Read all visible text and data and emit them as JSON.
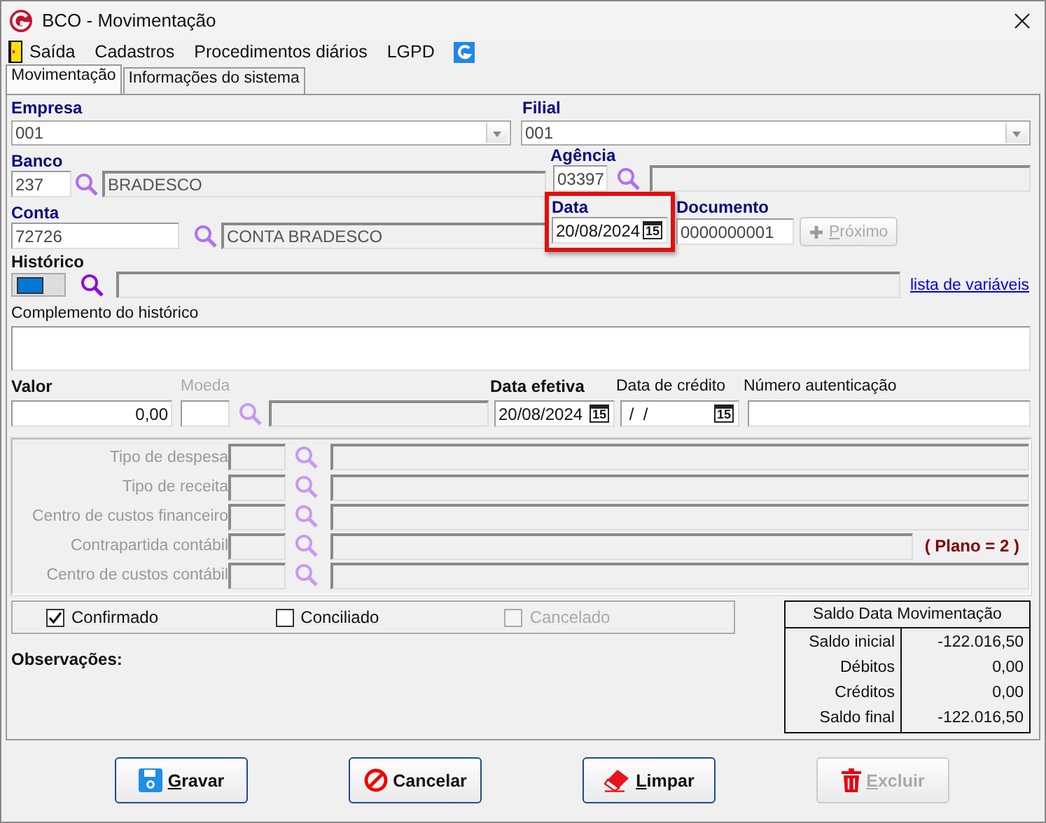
{
  "window": {
    "title": "BCO - Movimentação"
  },
  "menu": [
    {
      "label": "Saída",
      "kind": "exit"
    },
    {
      "label": "Cadastros",
      "kind": "text"
    },
    {
      "label": "Procedimentos diários",
      "kind": "text"
    },
    {
      "label": "LGPD",
      "kind": "text"
    },
    {
      "kind": "logo"
    }
  ],
  "tabs": [
    {
      "label": "Movimentação",
      "selected": true
    },
    {
      "label": "Informações do sistema",
      "selected": false
    }
  ],
  "empresa": {
    "label": "Empresa",
    "value": "001"
  },
  "filial": {
    "label": "Filial",
    "value": "001"
  },
  "banco": {
    "label": "Banco",
    "code": "237",
    "name": "BRADESCO"
  },
  "agencia": {
    "label": "Agência",
    "code": "03397"
  },
  "conta": {
    "label": "Conta",
    "code": "72726",
    "name": "CONTA BRADESCO"
  },
  "data": {
    "label": "Data",
    "value": "20/08/2024",
    "calendar": "15",
    "highlighted": true
  },
  "documento": {
    "label": "Documento",
    "value": "0000000001",
    "button": {
      "accel": "P",
      "text": "róximo",
      "disabled": true
    }
  },
  "historico": {
    "label": "Histórico",
    "link": "lista de variáveis"
  },
  "complemento": {
    "label": "Complemento do histórico"
  },
  "valor": {
    "label": "Valor",
    "value": "0,00"
  },
  "moeda": {
    "label": "Moeda",
    "disabled": true
  },
  "data_efetiva": {
    "label": "Data efetiva",
    "value": "20/08/2024",
    "calendar": "15"
  },
  "data_credito": {
    "label": "Data de crédito",
    "value": " /  /",
    "calendar": "15"
  },
  "numero_autenticacao": {
    "label": "Número autenticação"
  },
  "classificacao": {
    "disabled": true,
    "plan_note": "( Plano = 2 )",
    "rows": [
      {
        "label": "Tipo de despesa"
      },
      {
        "label": "Tipo de receita"
      },
      {
        "label": "Centro de custos financeiro"
      },
      {
        "label": "Contrapartida contábil",
        "note": true
      },
      {
        "label": "Centro de custos contábil"
      }
    ]
  },
  "status": [
    {
      "label": "Confirmado",
      "checked": true,
      "disabled": false
    },
    {
      "label": "Conciliado",
      "checked": false,
      "disabled": false
    },
    {
      "label": "Cancelado",
      "checked": false,
      "disabled": true
    }
  ],
  "observacoes": {
    "label": "Observações:"
  },
  "saldo": {
    "title": "Saldo Data Movimentação",
    "rows": [
      {
        "label": "Saldo inicial",
        "value": "-122.016,50"
      },
      {
        "label": "Débitos",
        "value": "0,00"
      },
      {
        "label": "Créditos",
        "value": "0,00"
      },
      {
        "label": "Saldo final",
        "value": "-122.016,50"
      }
    ]
  },
  "buttons": [
    {
      "kind": "save",
      "accel": "G",
      "text": "ravar",
      "disabled": false
    },
    {
      "kind": "cancel",
      "text": "Cancelar",
      "disabled": false
    },
    {
      "kind": "clear",
      "accel": "L",
      "text": "impar",
      "disabled": false
    },
    {
      "kind": "delete",
      "accel": "E",
      "text": "xcluir",
      "disabled": true
    }
  ]
}
